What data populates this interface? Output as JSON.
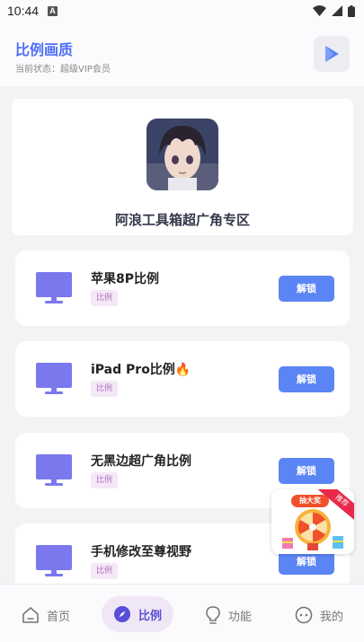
{
  "status_bar": {
    "time": "10:44",
    "indicator": "A"
  },
  "header": {
    "title": "比例画质",
    "subtitle": "当前状态：超级VIP会员",
    "play_icon": "play-triangle-icon"
  },
  "top_card": {
    "title": "阿浪工具箱超广角专区"
  },
  "items": [
    {
      "title": "苹果8P比例",
      "tag": "比例",
      "button": "解锁",
      "icon": "monitor-icon"
    },
    {
      "title": "iPad Pro比例",
      "title_emoji": "🔥",
      "tag": "比例",
      "button": "解锁",
      "icon": "monitor-icon"
    },
    {
      "title": "无黑边超广角比例",
      "tag": "比例",
      "button": "解锁",
      "icon": "monitor-icon"
    },
    {
      "title": "手机修改至尊视野",
      "tag": "比例",
      "button": "解锁",
      "icon": "monitor-icon"
    }
  ],
  "lottery": {
    "title": "抽大奖",
    "ribbon": "推荐"
  },
  "nav": {
    "items": [
      {
        "label": "首页",
        "icon": "home-icon"
      },
      {
        "label": "比例",
        "icon": "compass-icon",
        "active": true
      },
      {
        "label": "功能",
        "icon": "lightbulb-icon"
      },
      {
        "label": "我的",
        "icon": "face-icon"
      }
    ]
  },
  "colors": {
    "accent": "#4f6ef7",
    "button": "#5b84f4",
    "icon_purple": "#7b78ee",
    "tag_bg": "#f4e7f6",
    "nav_active_bg": "#efe7f6"
  }
}
